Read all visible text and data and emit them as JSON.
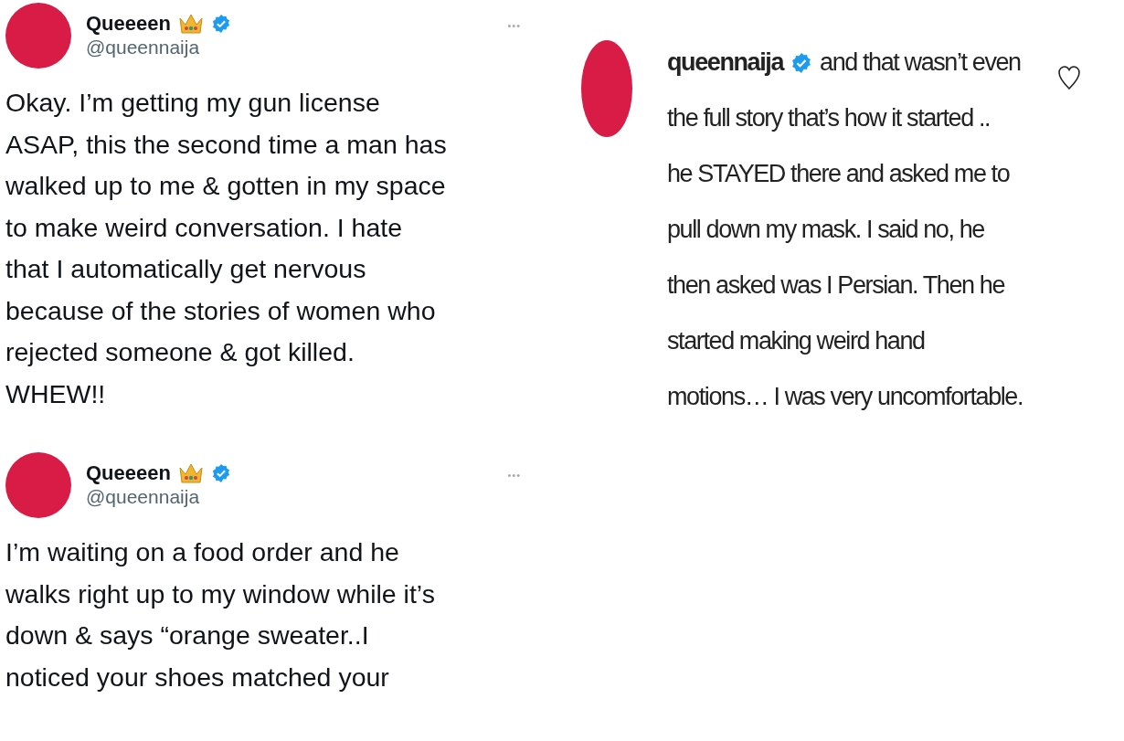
{
  "tweets": [
    {
      "display_name": "Queeeen",
      "verified": true,
      "handle": "@queennaija",
      "more": "•••",
      "lines": [
        "Okay. I’m getting my gun license",
        "ASAP, this the second time a man has",
        "walked up to me & gotten in my space",
        "to make weird conversation. I hate",
        "that I automatically get nervous",
        "because of the stories of women who",
        "rejected someone & got killed.",
        "WHEW!!"
      ]
    },
    {
      "display_name": "Queeeen",
      "verified": true,
      "handle": "@queennaija",
      "more": "•••",
      "lines": [
        "I’m waiting on a food order and he",
        "walks right up to my window while it’s",
        "down & says “orange sweater..I",
        "noticed your shoes matched your"
      ]
    }
  ],
  "comment": {
    "username": "queennaija",
    "verified": true,
    "liked": false,
    "lines": [
      "and that wasn’t even",
      "the full story that’s how it started ..",
      "he STAYED there and asked me to",
      "pull down my mask. I said no, he",
      "then asked was I Persian. Then he",
      "started making weird hand",
      "motions… I was very uncomfortable."
    ]
  }
}
